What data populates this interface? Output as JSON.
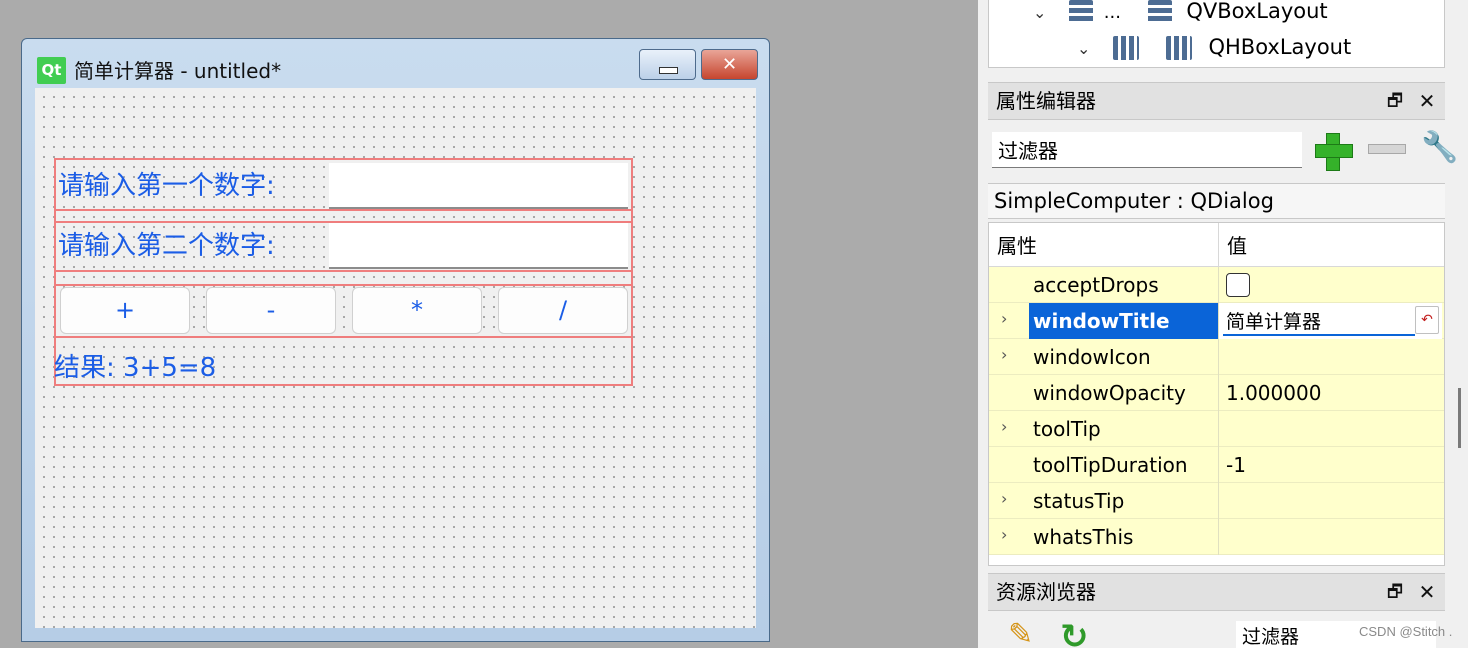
{
  "dialog": {
    "logo_text": "Qt",
    "title": "简单计算器 - untitled*",
    "minimize_icon": "minimize-icon",
    "close_symbol": "✕",
    "label_first": "请输入第一个数字:",
    "label_second": "请输入第二个数字:",
    "input_first_value": "",
    "input_second_value": "",
    "op_buttons": [
      "+",
      "-",
      "*",
      "/"
    ],
    "result_text": "结果: 3+5=8"
  },
  "object_tree": {
    "rows": [
      {
        "chevron": "⌄",
        "ellipsis": "...",
        "label": "QVBoxLayout",
        "icon": "vbox-layout-icon"
      },
      {
        "chevron": "⌄",
        "label": "QHBoxLayout",
        "icon": "hbox-layout-icon"
      }
    ]
  },
  "property_editor": {
    "title": "属性编辑器",
    "filter_value": "过滤器",
    "object_label": "SimpleComputer : QDialog",
    "col_property": "属性",
    "col_value": "值",
    "rows": [
      {
        "name": "acceptDrops",
        "value": "",
        "expandable": false,
        "checkbox": true
      },
      {
        "name": "windowTitle",
        "value": "简单计算器",
        "expandable": true,
        "selected": true
      },
      {
        "name": "windowIcon",
        "value": "",
        "expandable": true
      },
      {
        "name": "windowOpacity",
        "value": "1.000000",
        "expandable": false
      },
      {
        "name": "toolTip",
        "value": "",
        "expandable": true
      },
      {
        "name": "toolTipDuration",
        "value": "-1",
        "expandable": false
      },
      {
        "name": "statusTip",
        "value": "",
        "expandable": true
      },
      {
        "name": "whatsThis",
        "value": "",
        "expandable": true
      }
    ],
    "float_symbol": "🗗",
    "close_symbol": "✕"
  },
  "resource_browser": {
    "title": "资源浏览器",
    "filter_value": "过滤器",
    "float_symbol": "🗗",
    "close_symbol": "✕"
  },
  "watermark": "CSDN @Stitch .",
  "colors": {
    "accent_blue": "#1b5de6",
    "selection": "#0a64d8",
    "layout_outline": "#ef7d7d",
    "property_row_bg": "#ffffcc"
  }
}
